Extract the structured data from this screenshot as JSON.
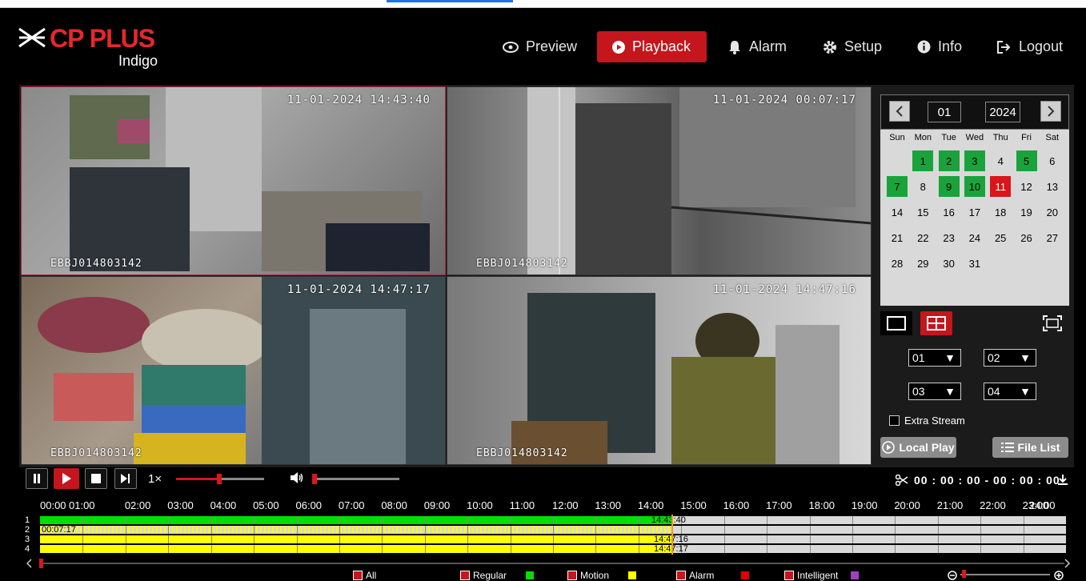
{
  "brand": {
    "name": "CP PLUS",
    "sub": "Indigo"
  },
  "nav": {
    "preview": "Preview",
    "playback": "Playback",
    "alarm": "Alarm",
    "setup": "Setup",
    "info": "Info",
    "logout": "Logout"
  },
  "cameras": [
    {
      "timestamp": "11-01-2024 14:43:40",
      "id": "EBBJ014803142"
    },
    {
      "timestamp": "11-01-2024 00:07:17",
      "id": "EBBJ014803142"
    },
    {
      "timestamp": "11-01-2024 14:47:17",
      "id": "EBBJ014803142"
    },
    {
      "timestamp": "11-01-2024 14:47:16",
      "id": "EBBJ014803142"
    }
  ],
  "calendar": {
    "month": "01",
    "year": "2024",
    "weekdays": [
      "Sun",
      "Mon",
      "Tue",
      "Wed",
      "Thu",
      "Fri",
      "Sat"
    ],
    "days": [
      "1",
      "2",
      "3",
      "4",
      "5",
      "6",
      "7",
      "8",
      "9",
      "10",
      "11",
      "12",
      "13",
      "14",
      "15",
      "16",
      "17",
      "18",
      "19",
      "20",
      "21",
      "22",
      "23",
      "24",
      "25",
      "26",
      "27",
      "28",
      "29",
      "30",
      "31"
    ],
    "recorded_days": [
      1,
      2,
      3,
      5,
      7,
      9,
      10
    ],
    "selected_day": 11,
    "rec_color": "#1aa33b",
    "selected_color": "#d9161c"
  },
  "channels": {
    "ch1": "01",
    "ch2": "02",
    "ch3": "03",
    "ch4": "04"
  },
  "extra_stream": "Extra Stream",
  "buttons": {
    "local_play": "Local Play",
    "file_list": "File List"
  },
  "playback": {
    "speed": "1×",
    "time_range": "00 : 00 : 00 - 00 : 00 : 00"
  },
  "timeline": {
    "hours": [
      "00:00",
      "01:00",
      "02:00",
      "03:00",
      "04:00",
      "05:00",
      "06:00",
      "07:00",
      "08:00",
      "09:00",
      "10:00",
      "11:00",
      "12:00",
      "13:00",
      "14:00",
      "15:00",
      "16:00",
      "17:00",
      "18:00",
      "19:00",
      "20:00",
      "21:00",
      "22:00",
      "23:00",
      "24:00"
    ],
    "rows": [
      "1",
      "2",
      "3",
      "4"
    ],
    "marks": [
      "14:43:40",
      "00:07:17",
      "14:47:16",
      "14:47:17"
    ]
  },
  "legend": {
    "all": "All",
    "regular": "Regular",
    "motion": "Motion",
    "alarm": "Alarm",
    "intelligent": "Intelligent",
    "regular_color": "#00e000",
    "motion_color": "#ffff00",
    "alarm_color": "#e00000",
    "intelligent_color": "#a040c0"
  }
}
